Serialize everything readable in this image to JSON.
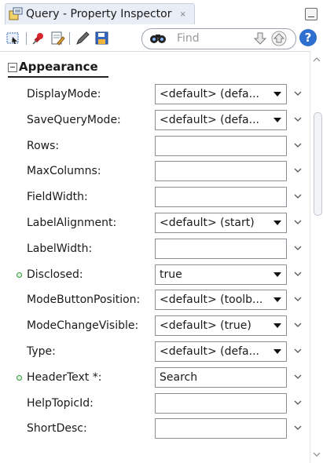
{
  "window": {
    "title": "Query - Property Inspector",
    "close_glyph": "×"
  },
  "toolbar": {
    "icons": [
      "select-icon",
      "pin-icon",
      "edit-icon",
      "pencil-icon",
      "save-icon"
    ],
    "find_placeholder": "Find",
    "help_label": "?"
  },
  "section": {
    "title": "Appearance"
  },
  "properties": [
    {
      "label": "DisplayMode:",
      "value": "<default> (defa...",
      "dropdown": true,
      "marker": false
    },
    {
      "label": "SaveQueryMode:",
      "value": "<default> (defa...",
      "dropdown": true,
      "marker": false
    },
    {
      "label": "Rows:",
      "value": "",
      "dropdown": false,
      "marker": false
    },
    {
      "label": "MaxColumns:",
      "value": "",
      "dropdown": false,
      "marker": false
    },
    {
      "label": "FieldWidth:",
      "value": "",
      "dropdown": false,
      "marker": false
    },
    {
      "label": "LabelAlignment:",
      "value": "<default> (start)",
      "dropdown": true,
      "marker": false
    },
    {
      "label": "LabelWidth:",
      "value": "",
      "dropdown": false,
      "marker": false
    },
    {
      "label": "Disclosed:",
      "value": "true",
      "dropdown": true,
      "marker": true
    },
    {
      "label": "ModeButtonPosition:",
      "value": "<default> (toolb...",
      "dropdown": true,
      "marker": false
    },
    {
      "label": "ModeChangeVisible:",
      "value": "<default> (true)",
      "dropdown": true,
      "marker": false
    },
    {
      "label": "Type:",
      "value": "<default> (defa...",
      "dropdown": true,
      "marker": false
    },
    {
      "label": "HeaderText *:",
      "value": "Search",
      "dropdown": false,
      "marker": true
    },
    {
      "label": "HelpTopicId:",
      "value": "",
      "dropdown": false,
      "marker": false
    },
    {
      "label": "ShortDesc:",
      "value": "",
      "dropdown": false,
      "marker": false
    }
  ],
  "colors": {
    "tab_bg": "#e9eef6",
    "modified_marker": "#2f9b3a",
    "help_blue": "#2f6fd0"
  }
}
